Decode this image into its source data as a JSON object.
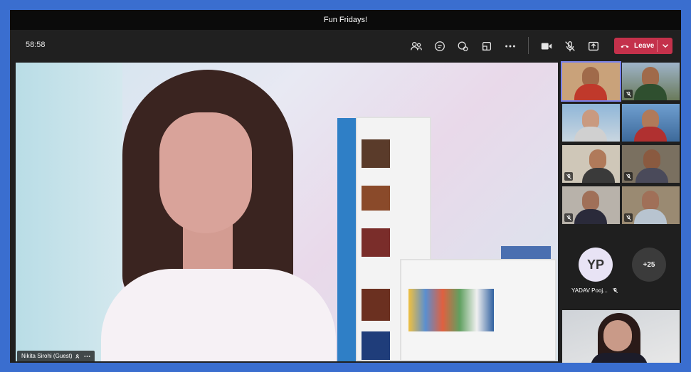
{
  "window": {
    "title": "Fun Fridays!"
  },
  "toolbar": {
    "timer": "58:58",
    "icons": [
      "people-icon",
      "chat-icon",
      "reactions-icon",
      "rooms-icon",
      "more-icon",
      "camera-icon",
      "mic-muted-icon",
      "share-icon"
    ],
    "leave_label": "Leave",
    "leave_color": "#c4314b"
  },
  "main": {
    "speaker_name": "Nikita Sirohi (Guest)"
  },
  "sidebar": {
    "avatar_initials": "YP",
    "avatar_name": "YADAV Pooj...",
    "overflow_count": "+25"
  }
}
